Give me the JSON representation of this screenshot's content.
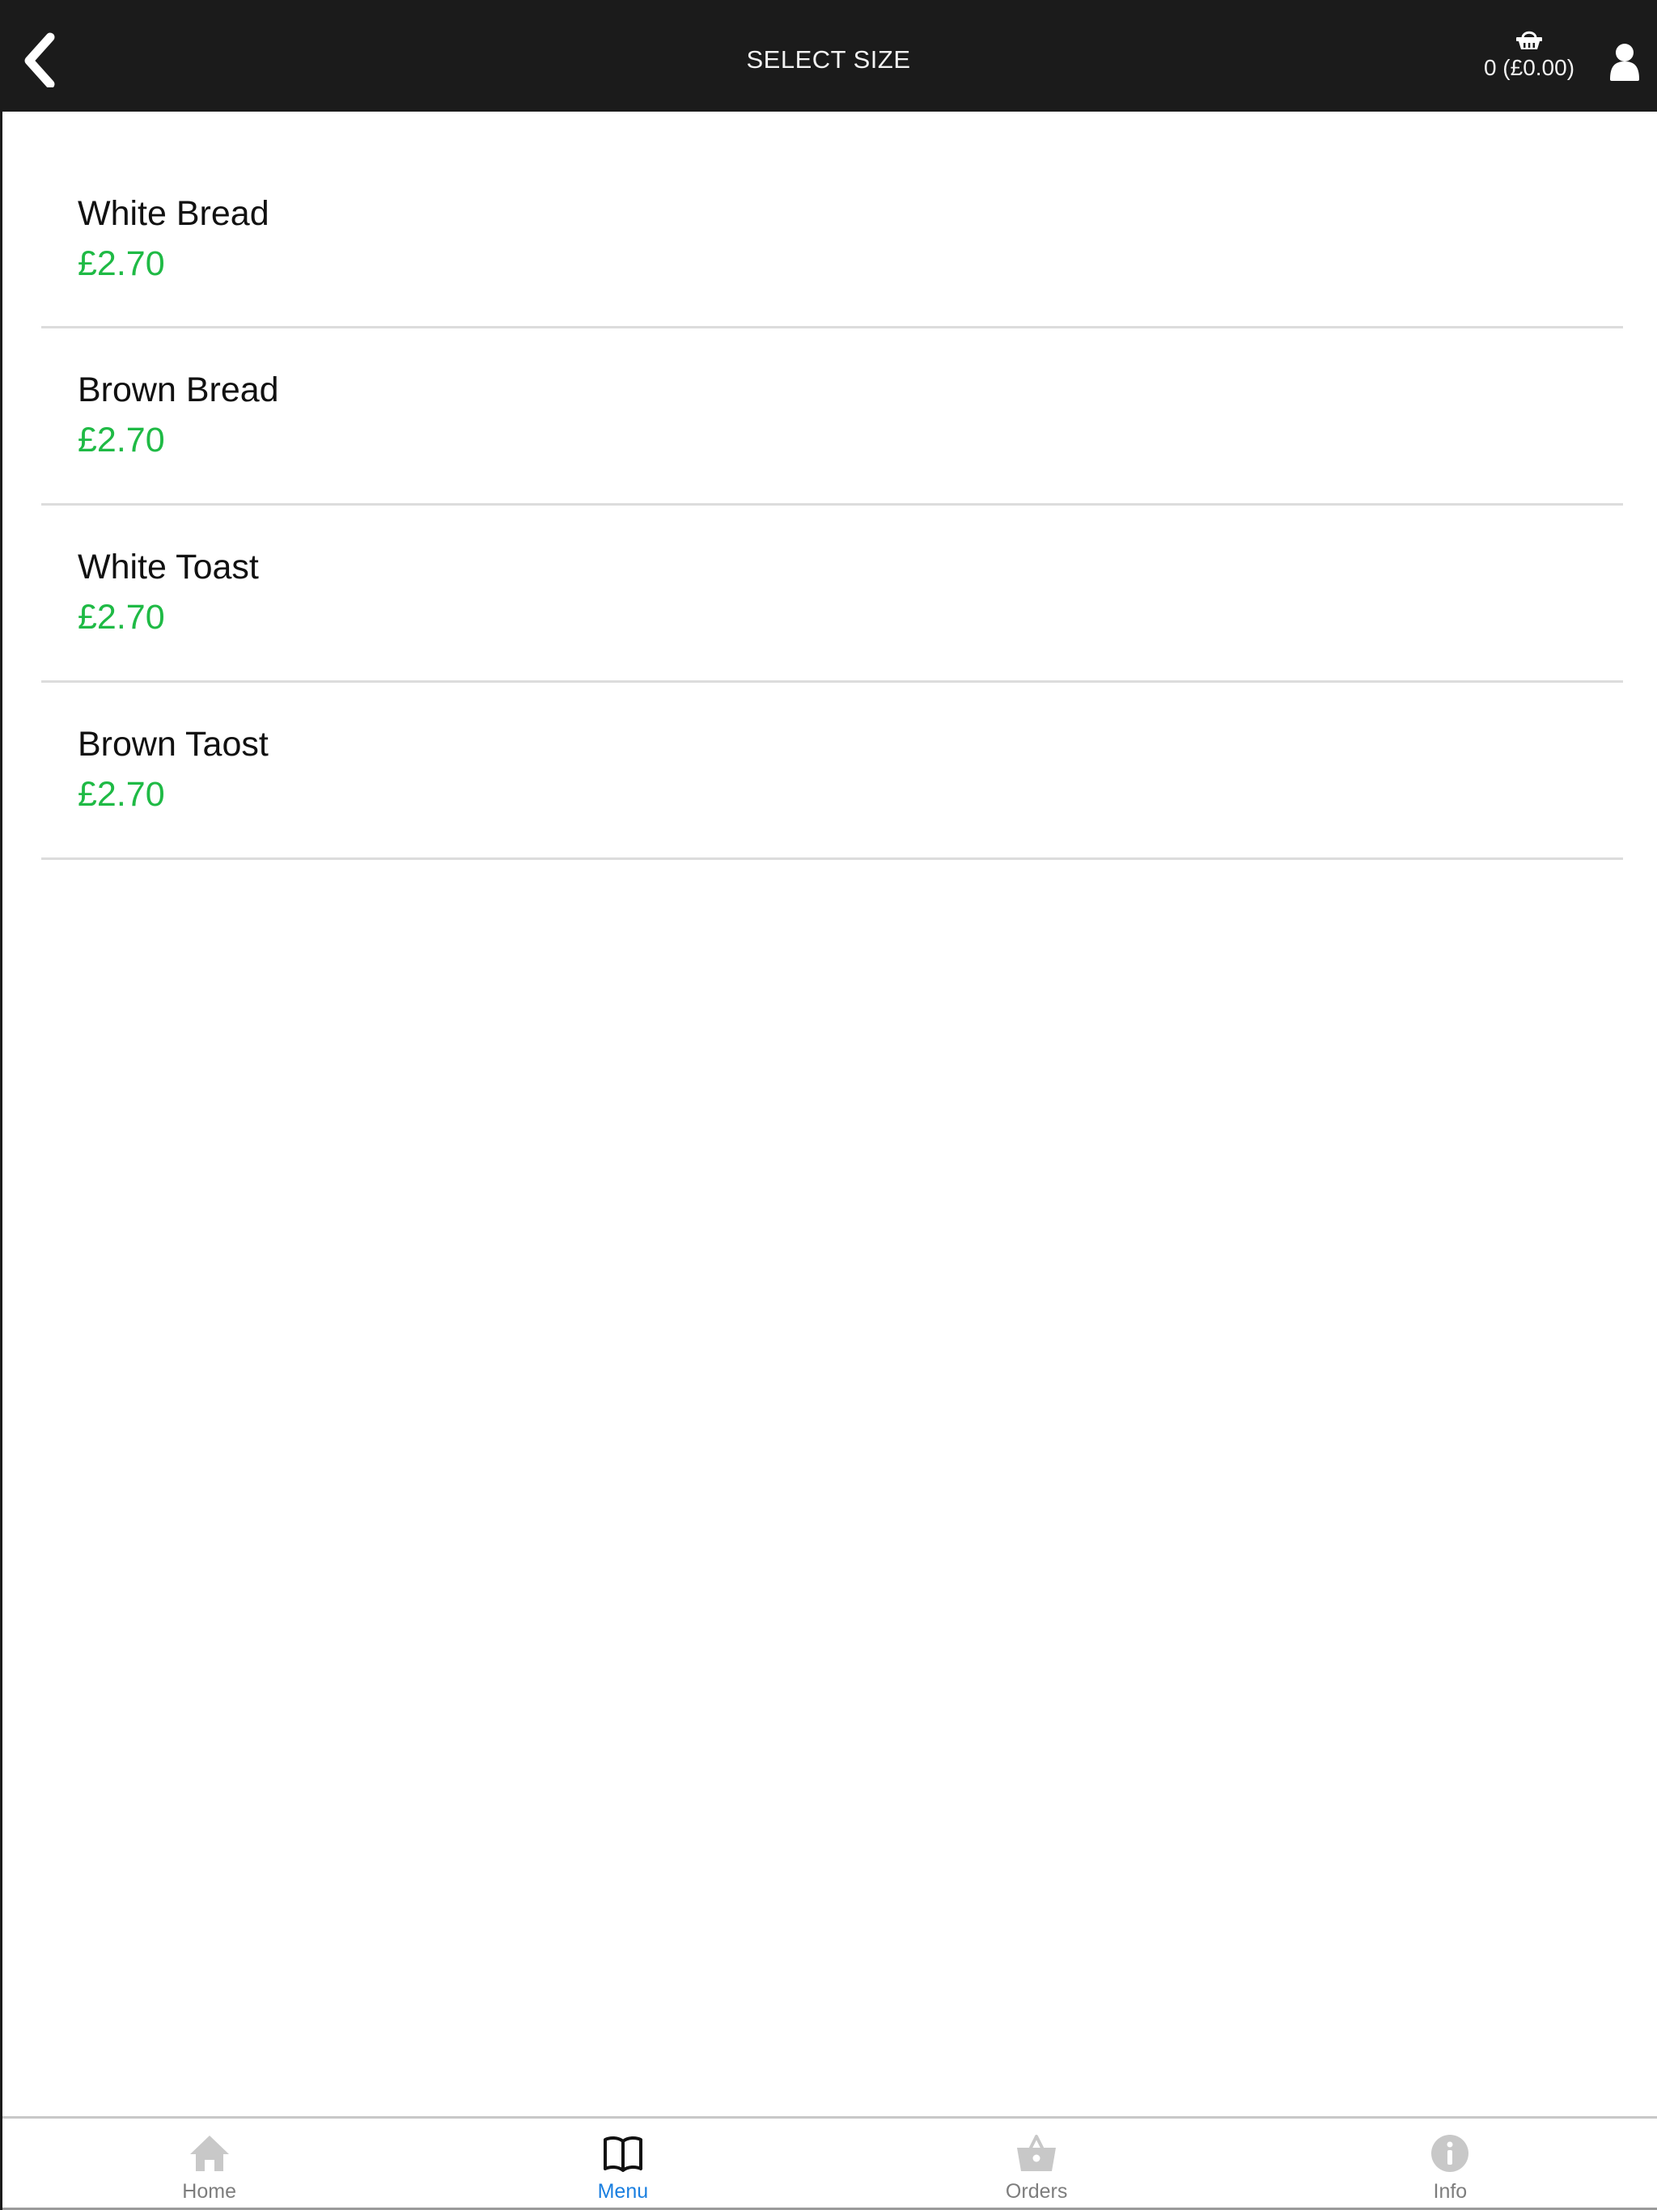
{
  "header": {
    "title": "SELECT SIZE",
    "back_icon": "chevron-left-icon",
    "cart": {
      "icon": "basket-icon",
      "count": "0",
      "total": "(£0.00)",
      "label": "0 (£0.00)"
    },
    "user_icon": "user-icon"
  },
  "items": [
    {
      "name": "White Bread",
      "price": "£2.70"
    },
    {
      "name": "Brown Bread",
      "price": "£2.70"
    },
    {
      "name": "White Toast",
      "price": "£2.70"
    },
    {
      "name": "Brown Taost",
      "price": "£2.70"
    }
  ],
  "bottom_nav": {
    "items": [
      {
        "label": "Home",
        "icon": "home-icon",
        "active": false
      },
      {
        "label": "Menu",
        "icon": "book-open-icon",
        "active": true
      },
      {
        "label": "Orders",
        "icon": "shopping-basket-icon",
        "active": false
      },
      {
        "label": "Info",
        "icon": "info-icon",
        "active": false
      }
    ]
  },
  "colors": {
    "header_bg": "#1b1b1b",
    "price": "#1fba45",
    "nav_active": "#1a7fe0",
    "nav_inactive": "#7d7d7d",
    "icon_inactive": "#c8c8c8"
  }
}
